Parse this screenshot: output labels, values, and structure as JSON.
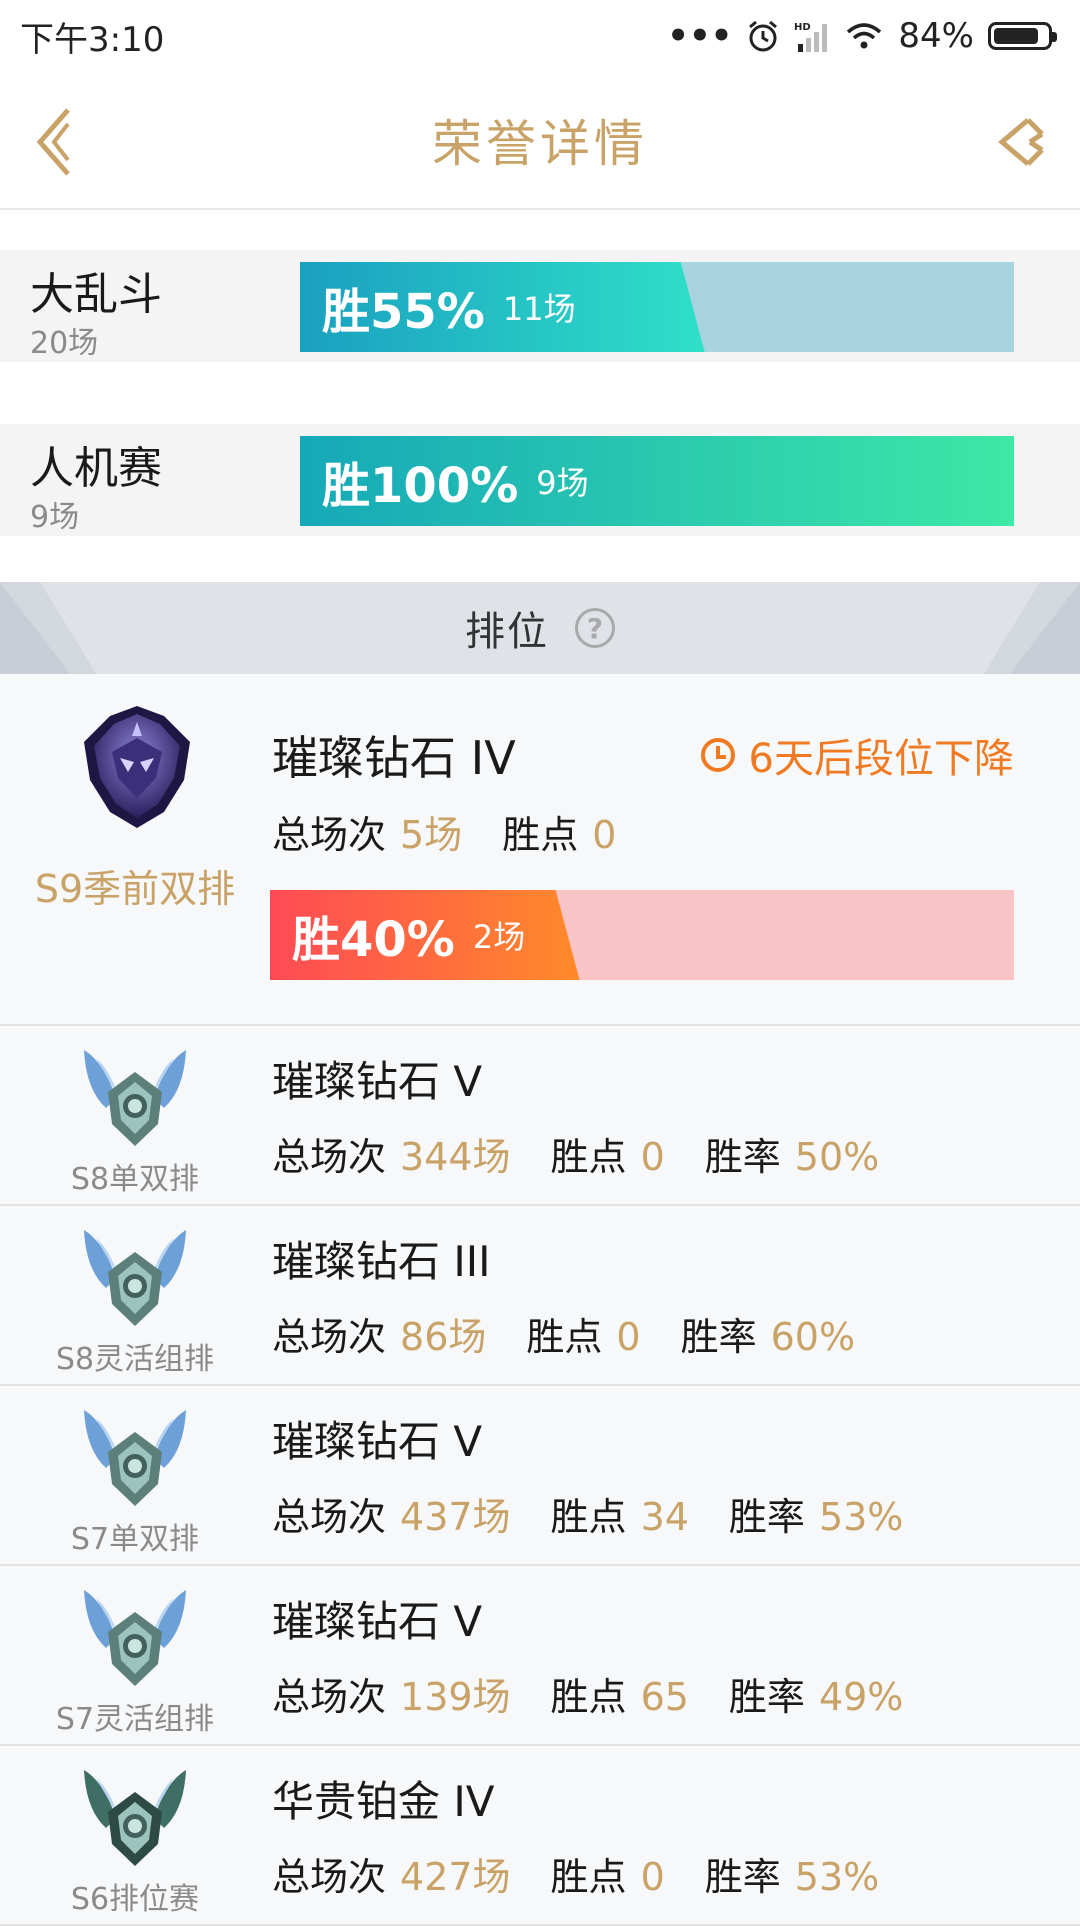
{
  "status": {
    "time": "下午3:10",
    "battery": "84%",
    "hd": "HD"
  },
  "nav": {
    "title": "荣誉详情"
  },
  "modes": [
    {
      "name": "大乱斗",
      "count": "20场",
      "win_label": "胜55%",
      "win_games": "11场",
      "win_rate": 0.55
    },
    {
      "name": "人机赛",
      "count": "9场",
      "win_label": "胜100%",
      "win_games": "9场",
      "win_rate": 1.0
    }
  ],
  "ranked": {
    "title": "排位",
    "help": "?",
    "current": {
      "tier": "璀璨钻石 IV",
      "season": "S9季前双排",
      "demote_text": "6天后段位下降",
      "total_label": "总场次",
      "total_value": "5场",
      "points_label": "胜点",
      "points_value": "0",
      "win_label": "胜40%",
      "win_games": "2场",
      "win_rate": 0.4
    },
    "history": [
      {
        "tier": "璀璨钻石 V",
        "season": "S8单双排",
        "total_label": "总场次",
        "total_value": "344场",
        "points_label": "胜点",
        "points_value": "0",
        "rate_label": "胜率",
        "rate_value": "50%",
        "emblem": "diamond-emblem"
      },
      {
        "tier": "璀璨钻石 III",
        "season": "S8灵活组排",
        "total_label": "总场次",
        "total_value": "86场",
        "points_label": "胜点",
        "points_value": "0",
        "rate_label": "胜率",
        "rate_value": "60%",
        "emblem": "diamond-emblem"
      },
      {
        "tier": "璀璨钻石 V",
        "season": "S7单双排",
        "total_label": "总场次",
        "total_value": "437场",
        "points_label": "胜点",
        "points_value": "34",
        "rate_label": "胜率",
        "rate_value": "53%",
        "emblem": "diamond-emblem"
      },
      {
        "tier": "璀璨钻石 V",
        "season": "S7灵活组排",
        "total_label": "总场次",
        "total_value": "139场",
        "points_label": "胜点",
        "points_value": "65",
        "rate_label": "胜率",
        "rate_value": "49%",
        "emblem": "diamond-emblem"
      },
      {
        "tier": "华贵铂金 IV",
        "season": "S6排位赛",
        "total_label": "总场次",
        "total_value": "427场",
        "points_label": "胜点",
        "points_value": "0",
        "rate_label": "胜率",
        "rate_value": "53%",
        "emblem": "platinum-emblem"
      }
    ]
  },
  "colors": {
    "gold": "#c9a267",
    "orange": "#f07a22",
    "mode1_bg": "#a8d4e0",
    "mode2_bg": "#3be8a8",
    "rank_bg": "#f8c4c6"
  }
}
